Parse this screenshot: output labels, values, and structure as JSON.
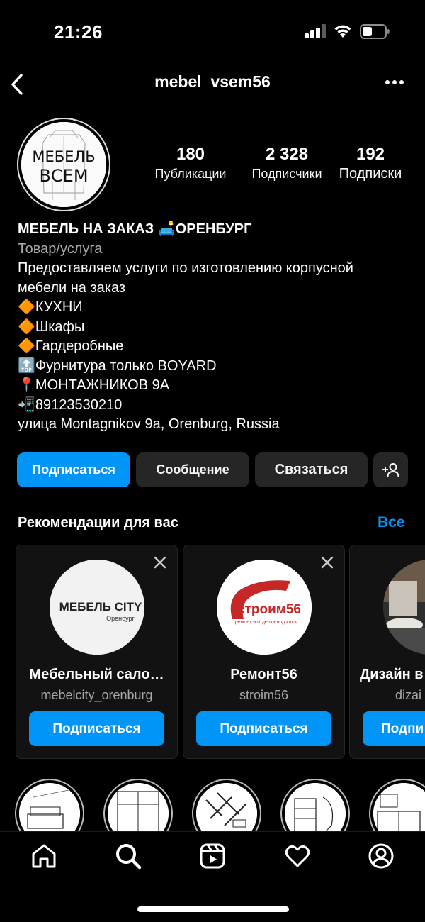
{
  "status_bar": {
    "time": "21:26"
  },
  "header": {
    "username": "mebel_vsem56"
  },
  "profile": {
    "avatar_text_line1": "МЕБЕЛЬ",
    "avatar_text_line2": "ВСЕМ",
    "stats": [
      {
        "value": "180",
        "label": "Публикации"
      },
      {
        "value": "2 328",
        "label": "Подписчики"
      },
      {
        "value": "192",
        "label": "Подписки"
      }
    ],
    "bio": {
      "name": "МЕБЕЛЬ НА ЗАКАЗ 🛋️ОРЕНБУРГ",
      "category": "Товар/услуга",
      "line1": "Предоставляем услуги по изготовлению корпусной",
      "line2": "мебели на заказ",
      "line3": "🔶КУХНИ",
      "line4": "🔶Шкафы",
      "line5": "🔶Гардеробные",
      "line6": "🔝Фурнитура только BOYARD",
      "line7": "📍МОНТАЖНИКОВ 9А",
      "line8": "📲89123530210",
      "address": "улица Montagnikov 9a, Orenburg, Russia"
    }
  },
  "actions": {
    "follow": "Подписаться",
    "message": "Сообщение",
    "contact": "Связаться"
  },
  "recommendations": {
    "title": "Рекомендации для вас",
    "see_all": "Все",
    "cards": [
      {
        "name": "Мебельный сало…",
        "handle": "mebelcity_orenburg",
        "button": "Подписаться",
        "logo_text": "МЕБЕЛЬ CITY",
        "logo_sub": "Оренбург"
      },
      {
        "name": "Ремонт56",
        "handle": "stroim56",
        "button": "Подписаться",
        "logo_text": "строим56",
        "logo_sub": "ремонт и отделка под ключ"
      },
      {
        "name": "Дизайн в",
        "handle": "dizai",
        "button": "Подпи"
      }
    ]
  },
  "colors": {
    "accent": "#0095f6",
    "background": "#000000",
    "secondary_button": "#262626",
    "muted_text": "#a8a8a8"
  },
  "icons": {
    "tabbar": [
      "home-icon",
      "search-icon",
      "reels-icon",
      "heart-icon",
      "profile-icon"
    ]
  }
}
